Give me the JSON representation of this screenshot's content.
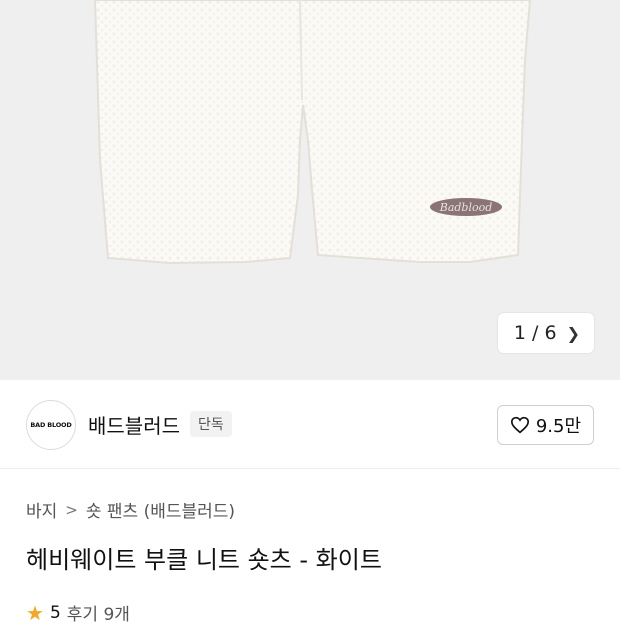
{
  "gallery": {
    "pager_current": "1",
    "pager_separator": "/",
    "pager_total": "6",
    "patch_color": "#8a7474"
  },
  "brand": {
    "logo_text": "BAD BLOOD",
    "name": "배드블러드",
    "tag": "단독"
  },
  "like": {
    "count": "9.5만"
  },
  "breadcrumb": [
    "바지",
    "숏 팬츠 (배드블러드)"
  ],
  "product": {
    "title": "헤비웨이트 부클 니트 숏츠 - 화이트"
  },
  "rating": {
    "score": "5",
    "reviews_label": "후기 9개"
  }
}
